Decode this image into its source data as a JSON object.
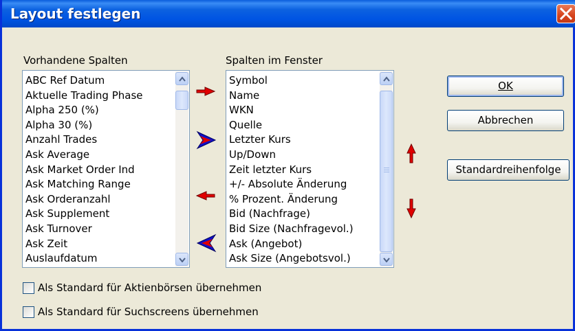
{
  "window": {
    "title": "Layout festlegen"
  },
  "available_columns": {
    "label": "Vorhandene Spalten",
    "items": [
      "ABC Ref Datum",
      "Aktuelle Trading Phase",
      "Alpha 250 (%)",
      "Alpha 30 (%)",
      "Anzahl Trades",
      "Ask Average",
      "Ask Market Order Ind",
      "Ask Matching Range",
      "Ask Orderanzahl",
      "Ask Supplement",
      "Ask Turnover",
      "Ask Zeit",
      "Auslaufdatum"
    ]
  },
  "window_columns": {
    "label": "Spalten im Fenster",
    "items": [
      "Symbol",
      "Name",
      "WKN",
      "Quelle",
      "Letzter Kurs",
      "Up/Down",
      "Zeit letzter Kurs",
      "+/- Absolute Änderung",
      "% Prozent. Änderung",
      "Bid (Nachfrage)",
      "Bid Size (Nachfragevol.)",
      "Ask (Angebot)",
      "Ask Size (Angebotsvol.)"
    ]
  },
  "buttons": {
    "ok": "OK",
    "cancel": "Abbrechen",
    "default_order": "Standardreihenfolge"
  },
  "checkboxes": {
    "stock_exchanges": "Als Standard für Aktienbörsen übernehmen",
    "search_screens": "Als Standard für Suchscreens übernehmen"
  },
  "icons": [
    "close-icon",
    "add-column-arrow-icon",
    "add-all-columns-arrow-icon",
    "remove-column-arrow-icon",
    "remove-all-columns-arrow-icon",
    "move-up-arrow-icon",
    "move-down-arrow-icon",
    "scroll-up-icon",
    "scroll-down-icon"
  ],
  "colors": {
    "titlebar": "#0054e3",
    "close": "#d6431c",
    "arrow_red": "#e00000",
    "arrow_blue": "#1010c8"
  }
}
